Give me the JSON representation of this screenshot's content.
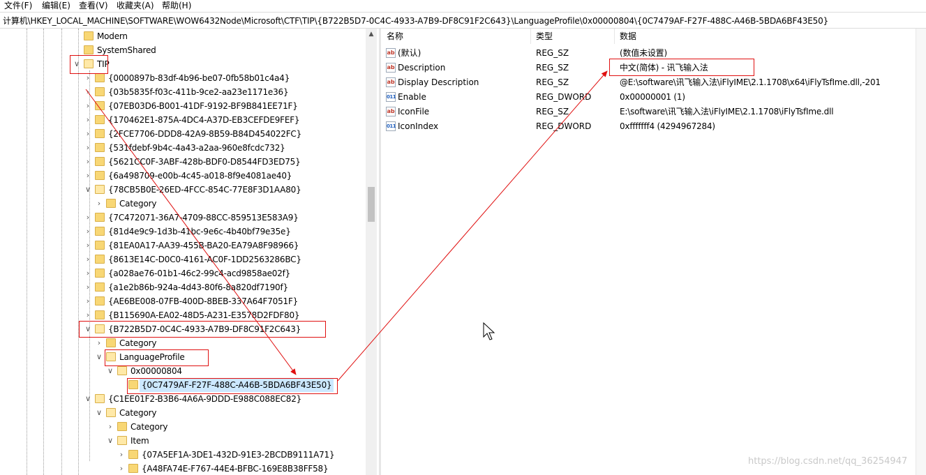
{
  "menu": [
    "文件(F)",
    "编辑(E)",
    "查看(V)",
    "收藏夹(A)",
    "帮助(H)"
  ],
  "address": "计算机\\HKEY_LOCAL_MACHINE\\SOFTWARE\\WOW6432Node\\Microsoft\\CTF\\TIP\\{B722B5D7-0C4C-4933-A7B9-DF8C91F2C643}\\LanguageProfile\\0x00000804\\{0C7479AF-F27F-488C-A46B-5BDA6BF43E50}",
  "tree": [
    {
      "label": "Modern",
      "expander": "",
      "level": 0
    },
    {
      "label": "SystemShared",
      "expander": "",
      "level": 0
    },
    {
      "label": "TIP",
      "expander": "∨",
      "level": 0
    },
    {
      "label": "{0000897b-83df-4b96-be07-0fb58b01c4a4}",
      "expander": "›",
      "level": 1
    },
    {
      "label": "{03b5835f-f03c-411b-9ce2-aa23e1171e36}",
      "expander": "›",
      "level": 1
    },
    {
      "label": "{07EB03D6-B001-41DF-9192-BF9B841EE71F}",
      "expander": "›",
      "level": 1
    },
    {
      "label": "{170462E1-875A-4DC4-A37D-EB3CEFDE9FEF}",
      "expander": "›",
      "level": 1
    },
    {
      "label": "{2FCE7706-DDD8-42A9-8B59-B84D454022FC}",
      "expander": "›",
      "level": 1
    },
    {
      "label": "{531fdebf-9b4c-4a43-a2aa-960e8fcdc732}",
      "expander": "›",
      "level": 1
    },
    {
      "label": "{5621CC0F-3ABF-428b-BDF0-D8544FD3ED75}",
      "expander": "›",
      "level": 1
    },
    {
      "label": "{6a498709-e00b-4c45-a018-8f9e4081ae40}",
      "expander": "›",
      "level": 1
    },
    {
      "label": "{78CB5B0E-26ED-4FCC-854C-77E8F3D1AA80}",
      "expander": "∨",
      "level": 1
    },
    {
      "label": "Category",
      "expander": "›",
      "level": 2
    },
    {
      "label": "{7C472071-36A7-4709-88CC-859513E583A9}",
      "expander": "›",
      "level": 1
    },
    {
      "label": "{81d4e9c9-1d3b-41bc-9e6c-4b40bf79e35e}",
      "expander": "›",
      "level": 1
    },
    {
      "label": "{81EA0A17-AA39-455B-BA20-EA79A8F98966}",
      "expander": "›",
      "level": 1
    },
    {
      "label": "{8613E14C-D0C0-4161-AC0F-1DD2563286BC}",
      "expander": "›",
      "level": 1
    },
    {
      "label": "{a028ae76-01b1-46c2-99c4-acd9858ae02f}",
      "expander": "›",
      "level": 1
    },
    {
      "label": "{a1e2b86b-924a-4d43-80f6-8a820df7190f}",
      "expander": "›",
      "level": 1
    },
    {
      "label": "{AE6BE008-07FB-400D-8BEB-337A64F7051F}",
      "expander": "›",
      "level": 1
    },
    {
      "label": "{B115690A-EA02-48D5-A231-E3578D2FDF80}",
      "expander": "›",
      "level": 1
    },
    {
      "label": "{B722B5D7-0C4C-4933-A7B9-DF8C91F2C643}",
      "expander": "∨",
      "level": 1
    },
    {
      "label": "Category",
      "expander": "›",
      "level": 2
    },
    {
      "label": "LanguageProfile",
      "expander": "∨",
      "level": 2
    },
    {
      "label": "0x00000804",
      "expander": "∨",
      "level": 3
    },
    {
      "label": "{0C7479AF-F27F-488C-A46B-5BDA6BF43E50}",
      "expander": "",
      "level": 4,
      "selected": true
    },
    {
      "label": "{C1EE01F2-B3B6-4A6A-9DDD-E988C088EC82}",
      "expander": "∨",
      "level": 1
    },
    {
      "label": "Category",
      "expander": "∨",
      "level": 2
    },
    {
      "label": "Category",
      "expander": "›",
      "level": 3
    },
    {
      "label": "Item",
      "expander": "∨",
      "level": 3
    },
    {
      "label": "{07A5EF1A-3DE1-432D-91E3-2BCDB9111A71}",
      "expander": "›",
      "level": 4
    },
    {
      "label": "{A48FA74E-F767-44E4-BFBC-169E8B38FF58}",
      "expander": "›",
      "level": 4
    }
  ],
  "columns": {
    "name": "名称",
    "type": "类型",
    "data": "数据"
  },
  "values": [
    {
      "icon": "ab",
      "name": "(默认)",
      "type": "REG_SZ",
      "data": "(数值未设置)"
    },
    {
      "icon": "ab",
      "name": "Description",
      "type": "REG_SZ",
      "data": "中文(简体) - 讯飞输入法"
    },
    {
      "icon": "ab",
      "name": "Display Description",
      "type": "REG_SZ",
      "data": "@E:\\software\\讯飞输入法\\iFlyIME\\2.1.1708\\x64\\iFlyTsfIme.dll,-201"
    },
    {
      "icon": "bin",
      "name": "Enable",
      "type": "REG_DWORD",
      "data": "0x00000001 (1)"
    },
    {
      "icon": "ab",
      "name": "IconFile",
      "type": "REG_SZ",
      "data": "E:\\software\\讯飞输入法\\iFlyIME\\2.1.1708\\iFlyTsfIme.dll"
    },
    {
      "icon": "bin",
      "name": "IconIndex",
      "type": "REG_DWORD",
      "data": "0xfffffff4 (4294967284)"
    }
  ],
  "watermark": "https://blog.csdn.net/qq_36254947",
  "annotation_color": "#e01010",
  "selection_color": "#cce8ff",
  "folder_color": "#f8d775"
}
